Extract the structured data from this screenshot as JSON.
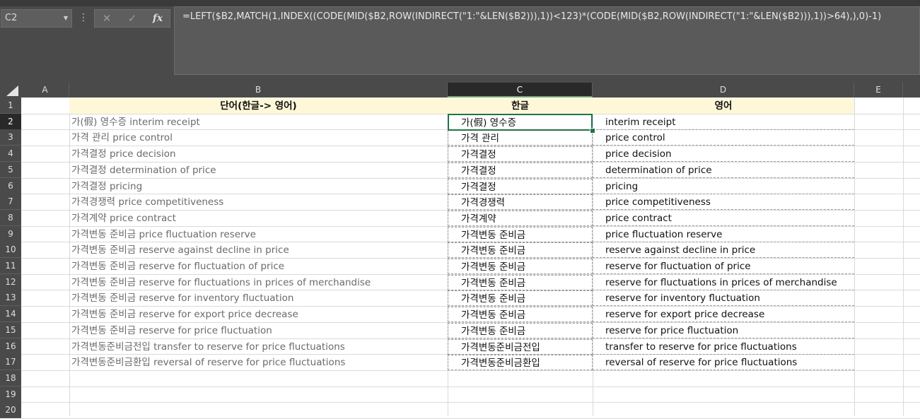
{
  "name_box": {
    "value": "C2"
  },
  "formula_bar": {
    "cancel_icon": "cancel-x-icon",
    "enter_icon": "checkmark-icon",
    "fx_label": "fx",
    "formula": "=LEFT($B2,MATCH(1,INDEX((CODE(MID($B2,ROW(INDIRECT(\"1:\"&LEN($B2))),1))<123)*(CODE(MID($B2,ROW(INDIRECT(\"1:\"&LEN($B2))),1))>64),),0)-1)"
  },
  "columns": [
    "A",
    "B",
    "C",
    "D",
    "E"
  ],
  "rows": [
    "1",
    "2",
    "3",
    "4",
    "5",
    "6",
    "7",
    "8",
    "9",
    "10",
    "11",
    "12",
    "13",
    "14",
    "15",
    "16",
    "17",
    "18",
    "19",
    "20"
  ],
  "selected_cell": "C2",
  "headers": {
    "b": "단어(한글-> 영어)",
    "c": "한글",
    "d": "영어"
  },
  "data_rows": [
    {
      "b": "가(假) 영수증 interim receipt",
      "c": "가(假) 영수증",
      "d": "interim receipt"
    },
    {
      "b": "가격 관리 price control",
      "c": "가격 관리",
      "d": "price control"
    },
    {
      "b": "가격결정 price decision",
      "c": "가격결정",
      "d": "price decision"
    },
    {
      "b": "가격결정 determination of price",
      "c": "가격결정",
      "d": "determination of price"
    },
    {
      "b": "가격결정 pricing",
      "c": "가격결정",
      "d": "pricing"
    },
    {
      "b": "가격경쟁력 price competitiveness",
      "c": "가격경쟁력",
      "d": "price competitiveness"
    },
    {
      "b": "가격계약 price contract",
      "c": "가격계약",
      "d": "price contract"
    },
    {
      "b": "가격변동 준비금 price fluctuation reserve",
      "c": "가격변동 준비금",
      "d": "price fluctuation reserve"
    },
    {
      "b": "가격변동 준비금 reserve against decline in price",
      "c": "가격변동 준비금",
      "d": "reserve against decline in price"
    },
    {
      "b": "가격변동 준비금 reserve for fluctuation of price",
      "c": "가격변동 준비금",
      "d": "reserve for fluctuation of price"
    },
    {
      "b": "가격변동 준비금 reserve for fluctuations in prices of merchandise",
      "c": "가격변동 준비금",
      "d": "reserve for fluctuations in prices of merchandise"
    },
    {
      "b": "가격변동 준비금 reserve for inventory fluctuation",
      "c": "가격변동 준비금",
      "d": "reserve for inventory fluctuation"
    },
    {
      "b": "가격변동 준비금 reserve for export price decrease",
      "c": "가격변동 준비금",
      "d": "reserve for export price decrease"
    },
    {
      "b": "가격변동 준비금 reserve for price fluctuation",
      "c": "가격변동 준비금",
      "d": "reserve for price fluctuation"
    },
    {
      "b": "가격변동준비금전입 transfer to reserve for price fluctuations",
      "c": "가격변동준비금전입",
      "d": "transfer to reserve for price fluctuations"
    },
    {
      "b": "가격변동준비금환입 reversal of reserve for price fluctuations",
      "c": "가격변동준비금환입",
      "d": "reversal of reserve for price fluctuations"
    }
  ],
  "colors": {
    "selection_border": "#217346",
    "header_fill": "#fff8d8",
    "chrome": "#4a4a4a"
  }
}
